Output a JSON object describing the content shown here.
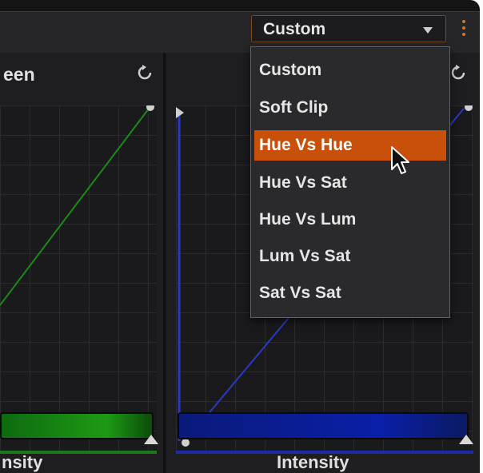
{
  "toolbar": {
    "mode_value": "Custom"
  },
  "panels": {
    "left_title": "een",
    "right_title": "",
    "left_bar_label": "nsity",
    "right_bar_label": "Intensity"
  },
  "dropdown": {
    "items": [
      "Custom",
      "Soft Clip",
      "Hue Vs Hue",
      "Hue Vs Sat",
      "Hue Vs Lum",
      "Lum Vs Sat",
      "Sat Vs Sat"
    ],
    "highlighted": "Hue Vs Hue"
  },
  "colors": {
    "accent": "#c8500a",
    "green_channel": "#1a7a18",
    "blue_channel": "#1c2aa8"
  },
  "icons": {
    "reset": "reset-icon",
    "more": "more-options-icon",
    "cursor": "mouse-pointer-icon",
    "dropdown_arrow": "chevron-down-icon"
  }
}
